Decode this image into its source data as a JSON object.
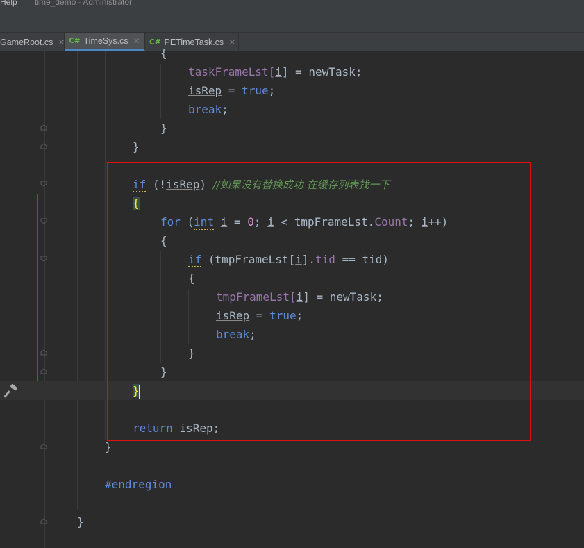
{
  "window": {
    "menu_help": "Help",
    "title": "time_demo - Administrator"
  },
  "tabs": [
    {
      "icon": "",
      "label": "GameRoot.cs",
      "close": "✕",
      "active": false
    },
    {
      "icon": "C#",
      "label": "TimeSys.cs",
      "close": "✕",
      "active": true
    },
    {
      "icon": "C#",
      "label": "PETimeTask.cs",
      "close": "✕",
      "active": false
    }
  ],
  "code": {
    "l1": "{",
    "l2_a": "taskFrameLst[",
    "l2_i": "i",
    "l2_b": "] = newTask;",
    "l3_var": "isRep",
    "l3_eq": " = ",
    "l3_val": "true",
    "l3_end": ";",
    "l4_kw": "break",
    "l4_end": ";",
    "l5": "}",
    "l6": "}",
    "l8_if": "if",
    "l8_a": " (!",
    "l8_var": "isRep",
    "l8_b": ") ",
    "l8_cmt": "//如果没有替换成功 在缓存列表找一下",
    "l9": "{",
    "l10_for": "for",
    "l10_a": " (",
    "l10_int": "int",
    "l10_sp": " ",
    "l10_i1": "i",
    "l10_b": " = ",
    "l10_zero": "0",
    "l10_c": "; ",
    "l10_i2": "i",
    "l10_d": " < tmpFrameLst.",
    "l10_count": "Count",
    "l10_e": "; ",
    "l10_i3": "i",
    "l10_f": "++)",
    "l11": "{",
    "l12_if": "if",
    "l12_a": " (tmpFrameLst[",
    "l12_i": "i",
    "l12_b": "].",
    "l12_tid": "tid",
    "l12_c": " == tid)",
    "l13": "{",
    "l14_a": "tmpFrameLst[",
    "l14_i": "i",
    "l14_b": "] = newTask;",
    "l15_var": "isRep",
    "l15_eq": " = ",
    "l15_val": "true",
    "l15_end": ";",
    "l16_kw": "break",
    "l16_end": ";",
    "l17": "}",
    "l18": "}",
    "l19": "}",
    "l21_kw": "return",
    "l21_sp": " ",
    "l21_var": "isRep",
    "l21_end": ";",
    "l22": "}",
    "l24": "#endregion",
    "l26": "}"
  },
  "colors": {
    "keyword": "#5e8ad6",
    "comment": "#629755",
    "number": "#d19ad1",
    "field": "#9876aa",
    "highlight_box": "#e01010"
  },
  "icons": {
    "hammer": "hammer-icon",
    "fold": "fold-marker-icon",
    "close": "close-icon"
  }
}
